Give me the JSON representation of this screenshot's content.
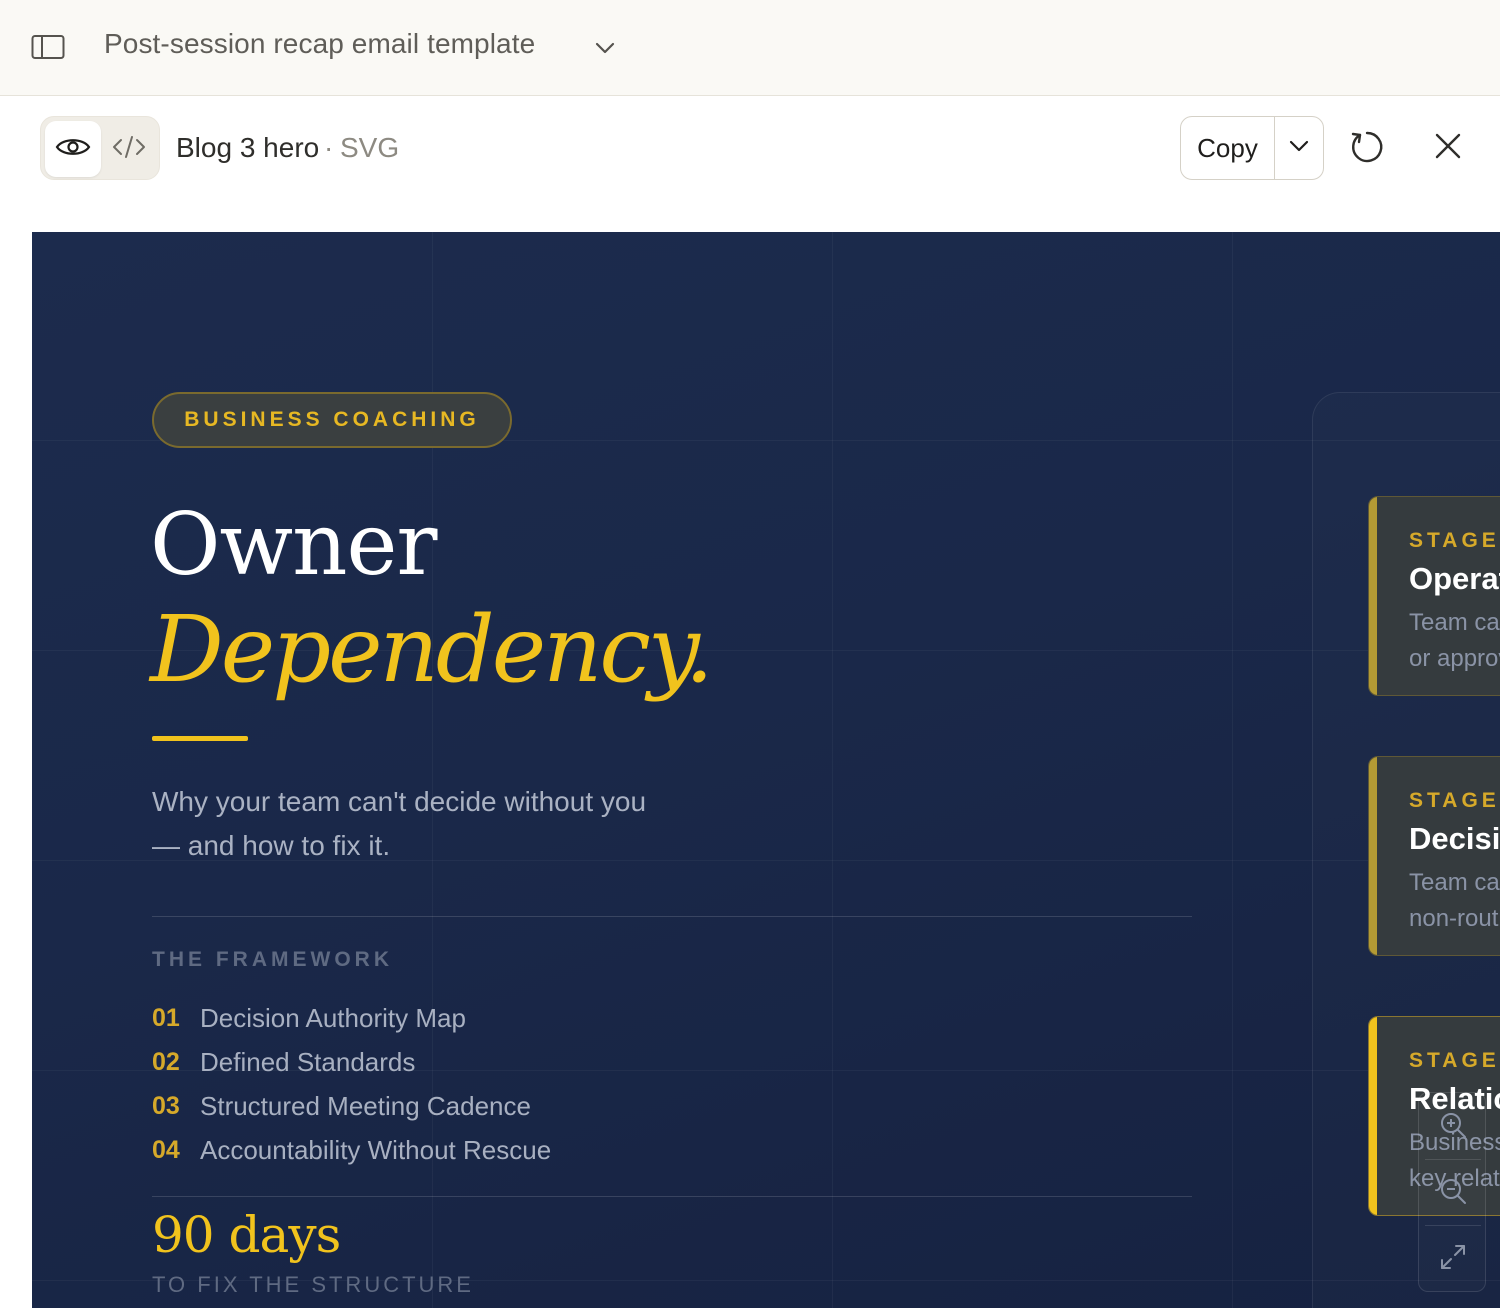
{
  "topbar": {
    "title": "Post-session recap email template"
  },
  "artifact": {
    "name": "Blog 3 hero",
    "separator": "·",
    "type": "SVG",
    "copy_label": "Copy"
  },
  "hero": {
    "tag": "BUSINESS COACHING",
    "title_line1": "Owner",
    "title_line2": "Dependency.",
    "subtitle": "Why your team can't decide without you — and how to fix it.",
    "framework_label": "THE FRAMEWORK",
    "framework": [
      {
        "num": "01",
        "text": "Decision Authority Map"
      },
      {
        "num": "02",
        "text": "Defined Standards"
      },
      {
        "num": "03",
        "text": "Structured Meeting Cadence"
      },
      {
        "num": "04",
        "text": "Accountability Without Rescue"
      }
    ],
    "stat_value": "90 days",
    "stat_label": "TO FIX THE STRUCTURE"
  },
  "stages": [
    {
      "eyebrow": "STAGE",
      "title": "Operat",
      "desc_line1": "Team ca",
      "desc_line2": "or approv"
    },
    {
      "eyebrow": "STAGE",
      "title": "Decisio",
      "desc_line1": "Team ca",
      "desc_line2": "non-routi"
    },
    {
      "eyebrow": "STAGE",
      "title": "Relatio",
      "desc_line1": "Business",
      "desc_line2": "key relat"
    }
  ],
  "colors": {
    "canvas_bg": "#1a2849",
    "accent_gold": "#f1c31d",
    "muted_text": "#aab2c3"
  },
  "icons": {
    "sidebar_toggle": "sidebar-toggle-icon",
    "title_dropdown": "chevron-down-icon",
    "preview": "eye-icon",
    "code": "code-icon",
    "copy_dropdown": "chevron-down-icon",
    "refresh": "refresh-icon",
    "close": "close-icon",
    "zoom_in": "zoom-in-icon",
    "zoom_out": "zoom-out-icon",
    "fit": "expand-icon"
  }
}
